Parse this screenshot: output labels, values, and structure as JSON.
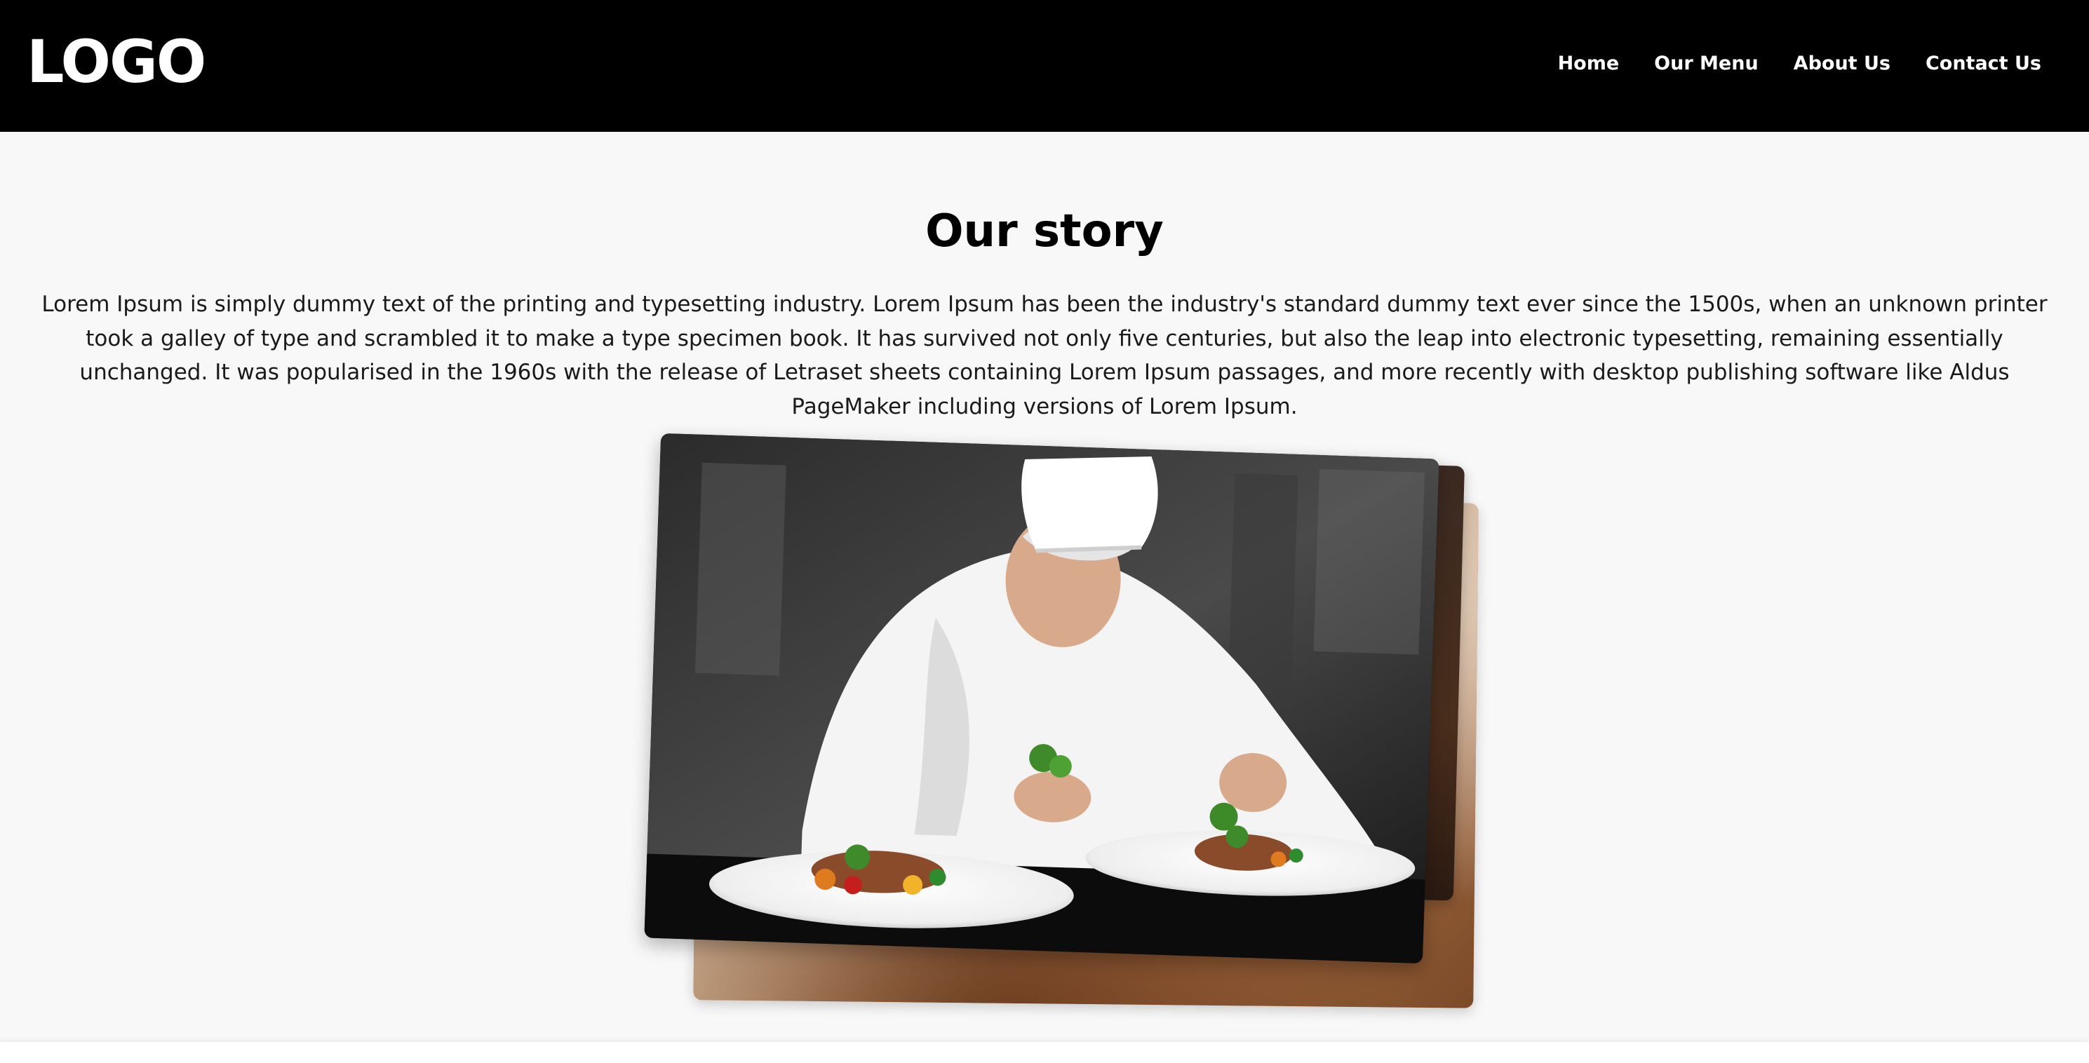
{
  "header": {
    "logo": "LOGO",
    "nav": [
      "Home",
      "Our Menu",
      "About Us",
      "Contact Us"
    ]
  },
  "story": {
    "title": "Our story",
    "body": "Lorem Ipsum is simply dummy text of the printing and typesetting industry. Lorem Ipsum has been the industry's standard dummy text ever since the 1500s, when an unknown printer took a galley of type and scrambled it to make a type specimen book. It has survived not only five centuries, but also the leap into electronic typesetting, remaining essentially unchanged. It was popularised in the 1960s with the release of Letraset sheets containing Lorem Ipsum passages, and more recently with desktop publishing software like Aldus PageMaker including versions of Lorem Ipsum."
  },
  "colors": {
    "header_bg": "#000000",
    "page_bg": "#f8f8f8",
    "text": "#1a1a1a"
  }
}
